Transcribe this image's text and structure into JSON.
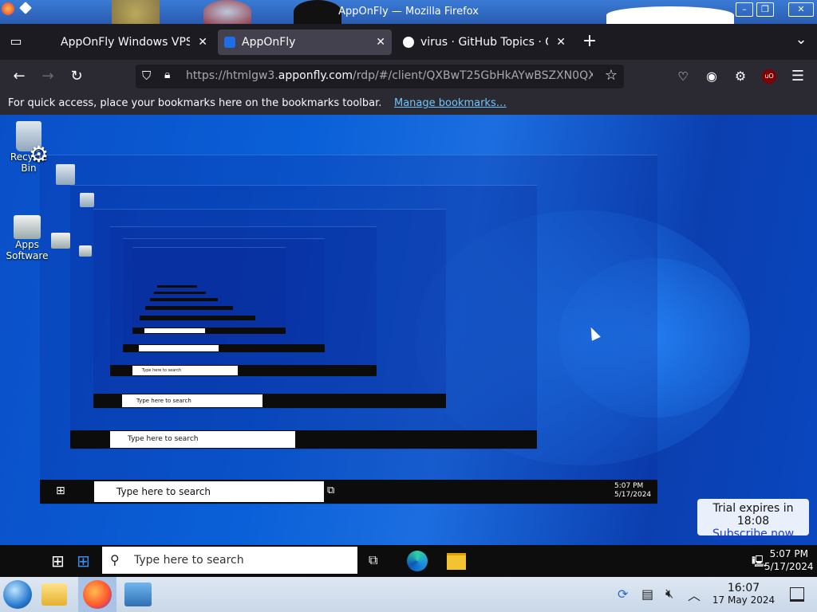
{
  "window": {
    "title": "AppOnFly — Mozilla Firefox",
    "buttons": [
      "–",
      "❐",
      "✕"
    ]
  },
  "tabs": [
    {
      "label": "AppOnFly Windows VPS",
      "active": false
    },
    {
      "label": "AppOnFly",
      "active": true
    },
    {
      "label": "virus · GitHub Topics · Gi",
      "active": false
    }
  ],
  "newtab_label": "+",
  "tablist_label": "⌄",
  "nav": {
    "url_prefix": "https://htmlgw3.",
    "url_domain": "apponfly.com",
    "url_suffix": "/rdp/#/client/QXBwT25GbHkAYwBSZXN0QX",
    "addon_badge": "uO"
  },
  "bookmarks": {
    "message": "For quick access, place your bookmarks here on the bookmarks toolbar.",
    "link": "Manage bookmarks…"
  },
  "remote": {
    "icons": [
      {
        "name": "recycle-bin",
        "label": "Recycle Bin"
      },
      {
        "name": "apps-software",
        "label": "Apps Software"
      }
    ],
    "search_placeholder": "Type here to search",
    "clock_time": "5:07 PM",
    "clock_date": "5/17/2024",
    "trial": {
      "text": "Trial expires in 18:08",
      "link": "Subscribe now"
    }
  },
  "host_taskbar": {
    "time": "16:07",
    "date": "17 May 2024"
  }
}
